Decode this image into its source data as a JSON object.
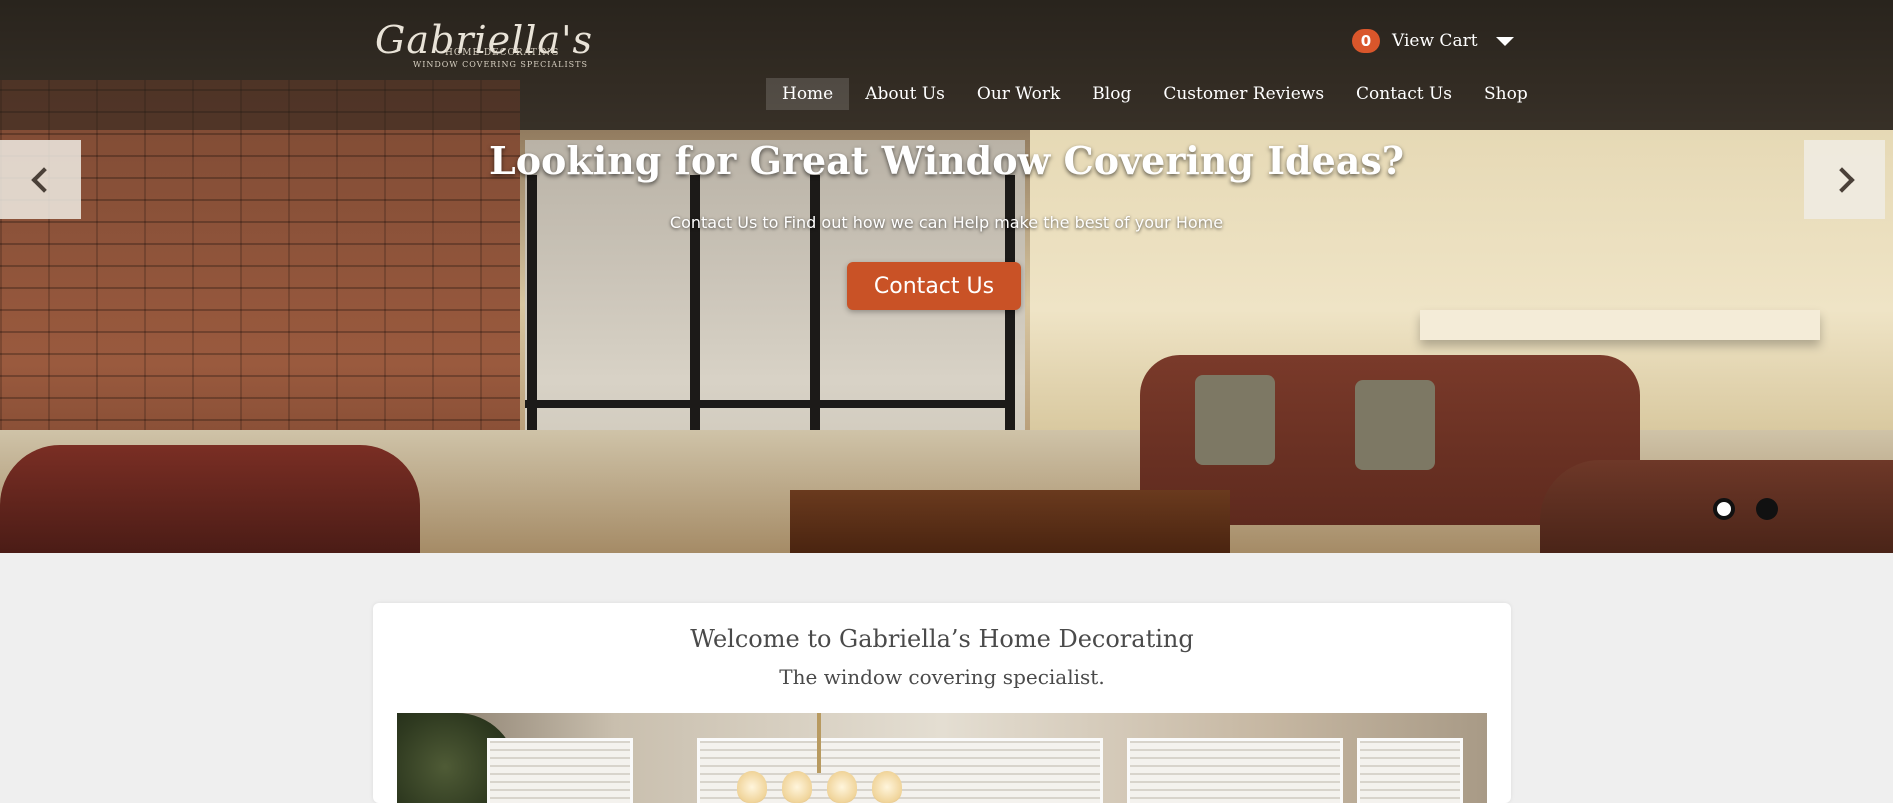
{
  "brand": {
    "logo_text": "Gabriella's",
    "logo_sub_1": "HOME DECORATING",
    "logo_sub_2": "WINDOW COVERING SPECIALISTS"
  },
  "cart": {
    "count": "0",
    "label": "View Cart",
    "caret_icon": "caret-down-icon"
  },
  "nav": {
    "items": [
      {
        "label": "Home",
        "active": true
      },
      {
        "label": "About Us"
      },
      {
        "label": "Our Work"
      },
      {
        "label": "Blog"
      },
      {
        "label": "Customer Reviews"
      },
      {
        "label": "Contact Us"
      },
      {
        "label": "Shop"
      }
    ]
  },
  "hero": {
    "title": "Looking for Great Window Covering Ideas?",
    "subtitle": "Contact Us to Find out how we can Help make the best of your Home",
    "button_label": "Contact Us",
    "prev_icon": "chevron-left-icon",
    "next_icon": "chevron-right-icon",
    "slides": 2,
    "active_slide": 1
  },
  "welcome": {
    "title": "Welcome to Gabriella’s Home Decorating",
    "subtitle": "The window covering specialist."
  },
  "colors": {
    "accent": "#c95226",
    "badge": "#d9562b",
    "background": "#efefef"
  }
}
